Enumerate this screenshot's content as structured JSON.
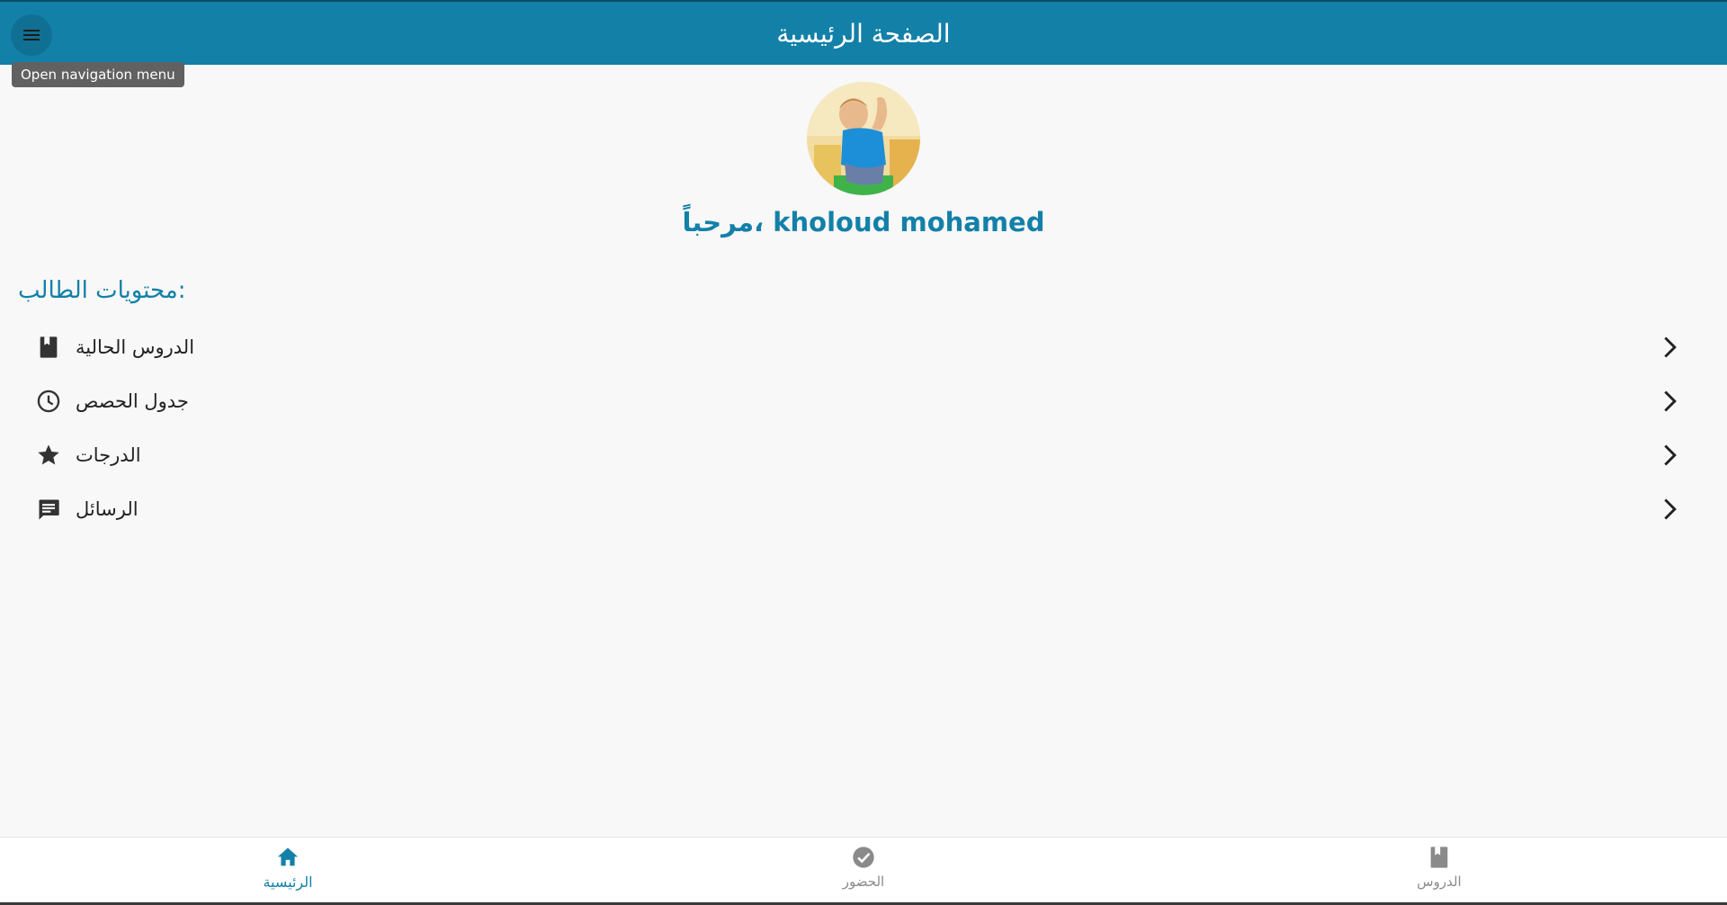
{
  "app_bar": {
    "title": "الصفحة الرئيسية",
    "menu_icon": "menu-icon",
    "tooltip": "Open navigation menu"
  },
  "profile": {
    "welcome": "مرحباً، kholoud mohamed"
  },
  "section": {
    "title": "محتويات الطالب:"
  },
  "menu_items": [
    {
      "label": "الدروس الحالية",
      "icon": "book-icon"
    },
    {
      "label": "جدول الحصص",
      "icon": "clock-icon"
    },
    {
      "label": "الدرجات",
      "icon": "star-icon"
    },
    {
      "label": "الرسائل",
      "icon": "message-icon"
    }
  ],
  "bottom_nav": {
    "items": [
      {
        "label": "الرئيسية",
        "icon": "home-icon",
        "active": true
      },
      {
        "label": "الحضور",
        "icon": "check-circle-icon",
        "active": false
      },
      {
        "label": "الدروس",
        "icon": "book-icon",
        "active": false
      }
    ]
  },
  "colors": {
    "primary": "#1380a8",
    "background": "#f8f8f8",
    "tooltip_bg": "#616161",
    "icon": "#333333",
    "inactive": "#8a8a8a"
  }
}
